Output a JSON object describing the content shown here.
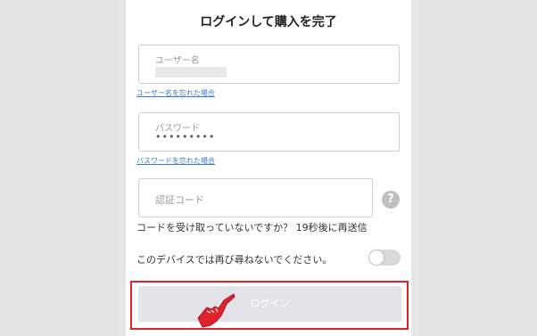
{
  "panel": {
    "title": "ログインして購入を完了"
  },
  "username": {
    "label": "ユーザー名",
    "forgot_link": "ユーザー名を忘れた場合"
  },
  "password": {
    "label": "パスワード",
    "value": "•••••••••",
    "forgot_link": "パスワードを忘れた場合"
  },
  "verification": {
    "label": "認証コード",
    "help_icon": "?",
    "resend_text": "コードを受け取っていないですか？ 19秒後に再送信"
  },
  "remember": {
    "label": "このデバイスでは再び尋ねないでください。",
    "enabled": false
  },
  "login": {
    "label": "ログイン",
    "highlight_color": "#e0232a"
  }
}
